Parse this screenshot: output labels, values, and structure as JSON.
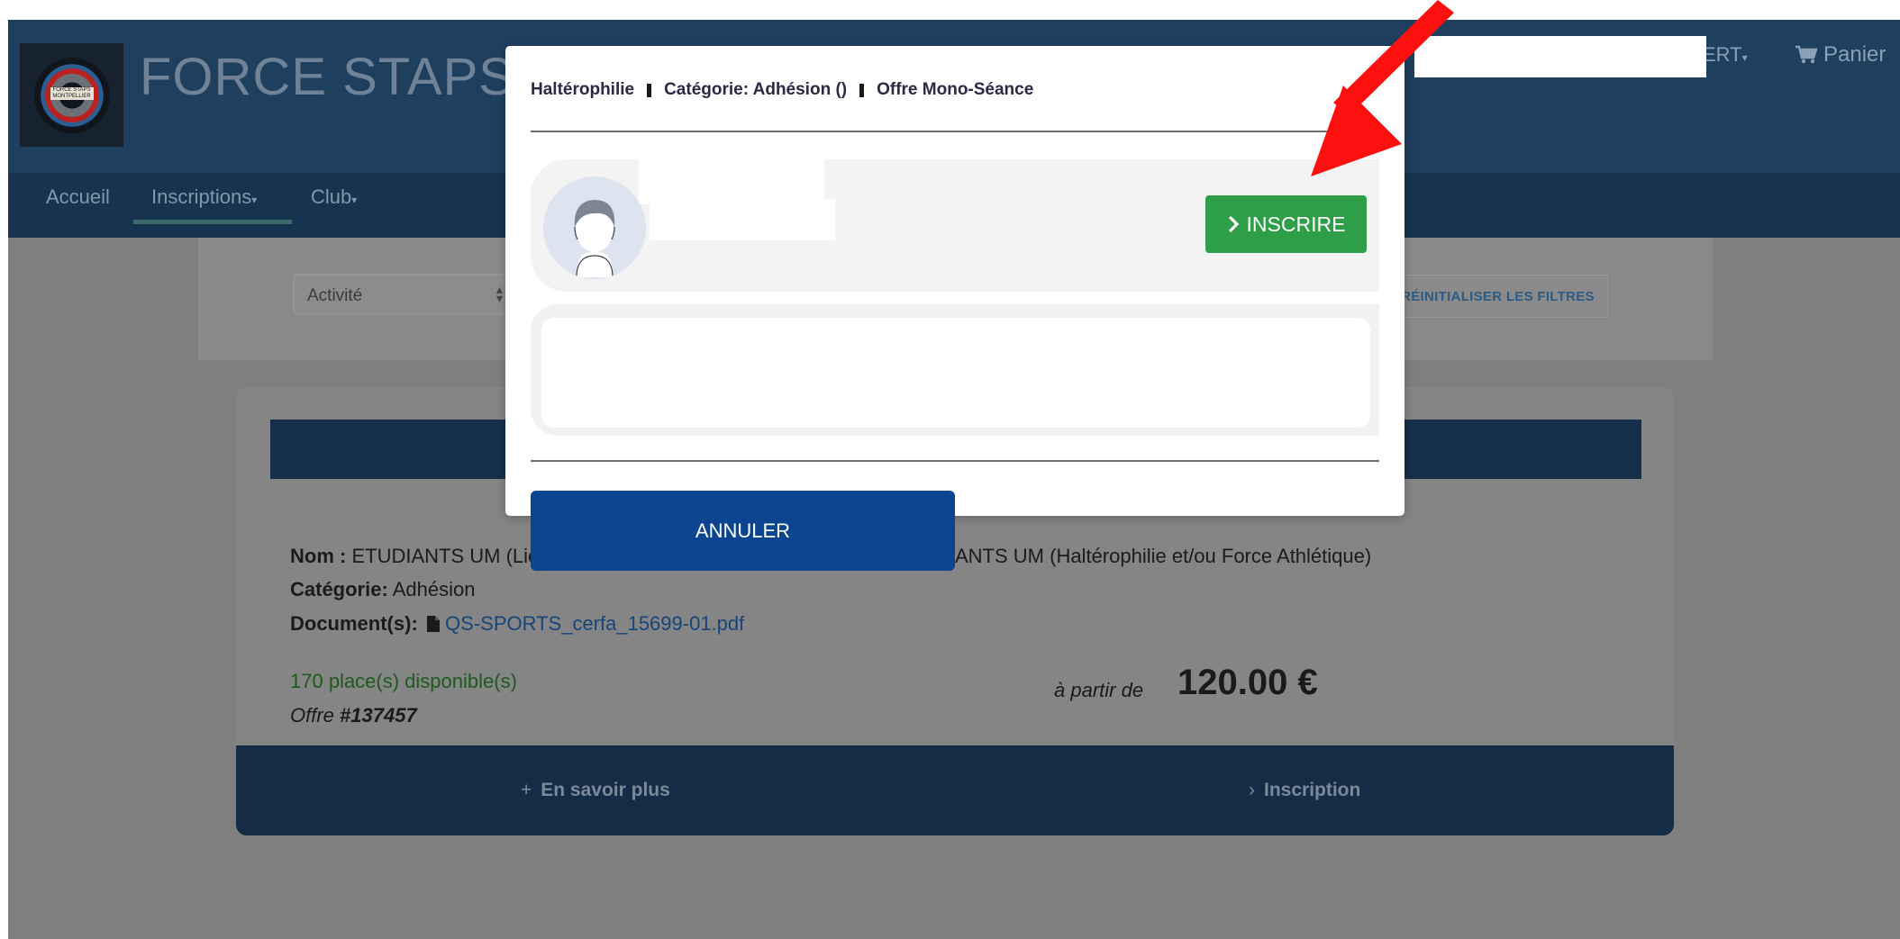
{
  "header": {
    "site_title": "FORCE STAPS MO",
    "logo_text": "FORCE STAPS MONTPELLIER",
    "user_menu_label": "ERT",
    "cart_label": "Panier"
  },
  "nav": {
    "items": [
      {
        "label": "Accueil"
      },
      {
        "label": "Inscriptions"
      },
      {
        "label": "Club"
      }
    ],
    "active": "Inscriptions"
  },
  "filters": {
    "activite_label": "Activité",
    "reset_label": "RÉINITIALISER LES FILTRES"
  },
  "offer": {
    "nom_label": "Nom :",
    "nom_value_left": "ETUDIANTS UM (Lic",
    "nom_value_right": "ANTS UM (Haltérophilie et/ou Force Athlétique)",
    "categorie_label": "Catégorie:",
    "categorie_value": "Adhésion",
    "documents_label": "Document(s):",
    "document_link": "QS-SPORTS_cerfa_15699-01.pdf",
    "places": "170 place(s) disponible(s)",
    "offer_prefix": "Offre",
    "offer_number": "#137457",
    "price_prefix": "à partir de",
    "price": "120.00 €",
    "footer_more": "En savoir plus",
    "footer_inscription": "Inscription"
  },
  "modal": {
    "breadcrumb": [
      "Haltérophilie",
      "Catégorie: Adhésion ()",
      "Offre Mono-Séance"
    ],
    "inscrire_label": "INSCRIRE",
    "annuler_label": "ANNULER"
  },
  "colors": {
    "header_bg": "#1f3f5f",
    "nav_bg": "#16334f",
    "inscrire_green": "#2e9e48",
    "annuler_blue": "#0b4591",
    "arrow_red": "#ff0000"
  }
}
